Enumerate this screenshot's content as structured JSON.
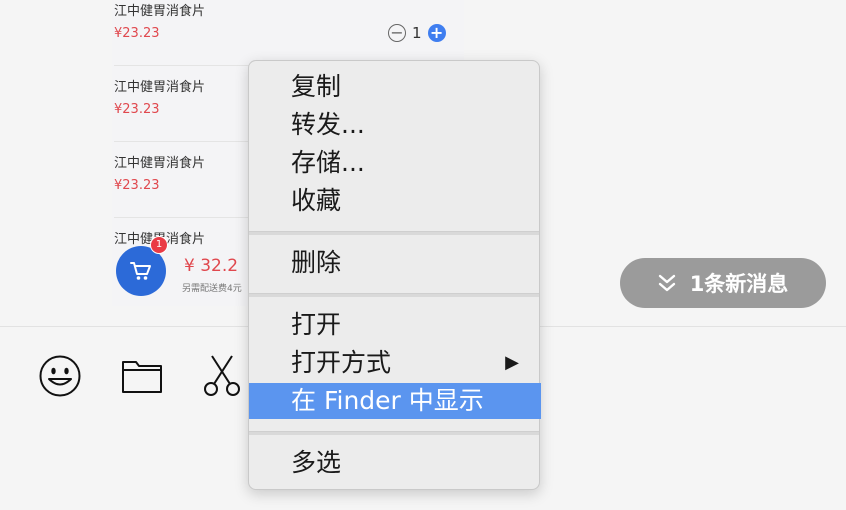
{
  "cart": {
    "items": [
      {
        "name": "江中健胃消食片",
        "price": "¥23.23"
      },
      {
        "name": "江中健胃消食片",
        "price": "¥23.23"
      },
      {
        "name": "江中健胃消食片",
        "price": "¥23.23"
      },
      {
        "name": "江中健胃消食片",
        "price": ""
      }
    ],
    "quantity": "1",
    "badge_count": "1",
    "total": "¥ 32.2",
    "delivery_note": "另需配送费4元"
  },
  "new_messages": {
    "label": "1条新消息",
    "icon": "double-chevron-down-icon"
  },
  "toolbar": {
    "icons": [
      "emoji-icon",
      "folder-icon",
      "scissors-icon"
    ]
  },
  "context_menu": {
    "copy": "复制",
    "forward": "转发...",
    "save": "存储...",
    "favorite": "收藏",
    "delete": "删除",
    "open": "打开",
    "open_with": "打开方式",
    "open_with_arrow": "▶",
    "show_in_finder": "在 Finder 中显示",
    "multi_select": "多选"
  },
  "colors": {
    "highlight": "#5b95ef",
    "price_red": "#e0484e",
    "accent_blue": "#2c6ad8",
    "pill_gray": "#9b9b9b"
  }
}
